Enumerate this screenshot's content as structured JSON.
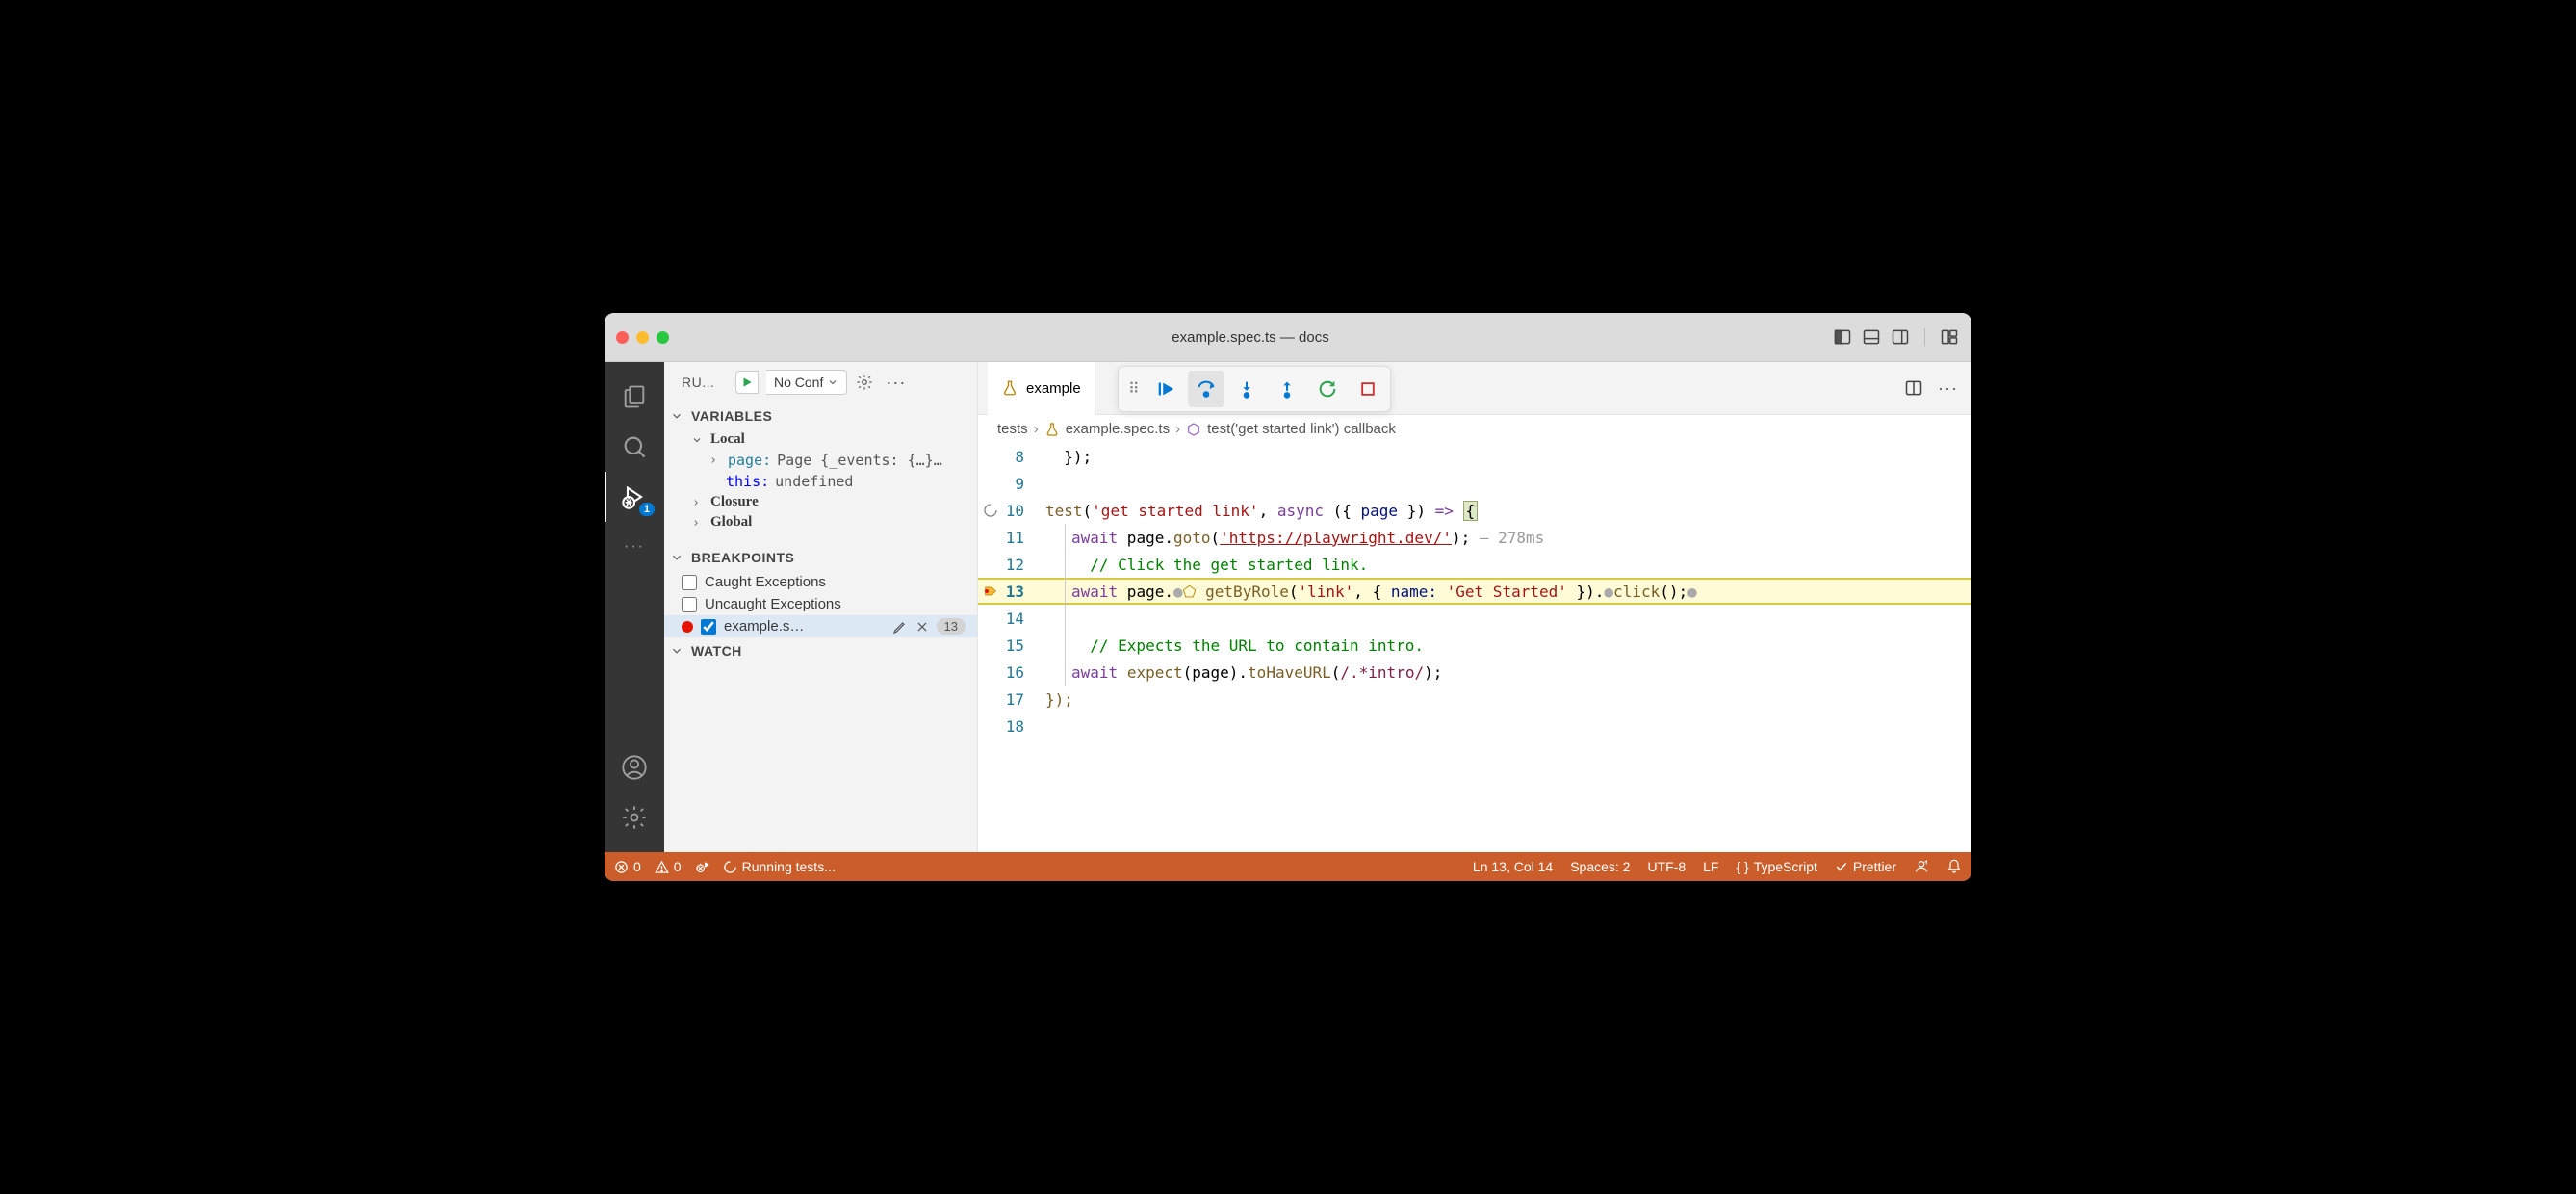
{
  "window_title": "example.spec.ts — docs",
  "activitybar": {
    "debug_badge": "1"
  },
  "sidebar": {
    "run_label": "RU...",
    "config_label": "No Conf",
    "sections": {
      "variables": "VARIABLES",
      "local": "Local",
      "closure": "Closure",
      "global": "Global",
      "breakpoints": "BREAKPOINTS",
      "watch": "WATCH"
    },
    "vars": {
      "page_name": "page:",
      "page_val": " Page {_events: {…}…",
      "this_name": "this:",
      "this_val": " undefined"
    },
    "bp": {
      "caught": "Caught Exceptions",
      "uncaught": "Uncaught Exceptions",
      "file_label": "example.s…",
      "line_badge": "13"
    }
  },
  "tab": {
    "label": "example"
  },
  "breadcrumb": {
    "a": "tests",
    "b": "example.spec.ts",
    "c": "test('get started link') callback"
  },
  "code": {
    "l8": "  });",
    "l9": "",
    "l10_a": "test",
    "l10_b": "(",
    "l10_c": "'get started link'",
    "l10_d": ", ",
    "l10_e": "async",
    "l10_f": " ({ ",
    "l10_g": "page",
    "l10_h": " }) ",
    "l10_i": "=>",
    "l10_j": " ",
    "l10_k": "{",
    "l11_a": "  ",
    "l11_b": "await",
    "l11_c": " page.",
    "l11_d": "goto",
    "l11_e": "(",
    "l11_f": "'https://playwright.dev/'",
    "l11_g": "); ",
    "l11_h": "— 278ms",
    "l12": "  // Click the get started link.",
    "l13_a": "  ",
    "l13_b": "await",
    "l13_c": " page.",
    "l13_d": "getByRole",
    "l13_e": "(",
    "l13_f": "'link'",
    "l13_g": ", { ",
    "l13_h": "name:",
    "l13_i": " ",
    "l13_j": "'Get Started'",
    "l13_k": " }).",
    "l13_l": "click",
    "l13_m": "();",
    "l14": "",
    "l15": "  // Expects the URL to contain intro.",
    "l16_a": "  ",
    "l16_b": "await",
    "l16_c": " ",
    "l16_d": "expect",
    "l16_e": "(page).",
    "l16_f": "toHaveURL",
    "l16_g": "(",
    "l16_h": "/.*intro/",
    "l16_i": ");",
    "l17": "});",
    "l18": ""
  },
  "line_numbers": [
    "8",
    "9",
    "10",
    "11",
    "12",
    "13",
    "14",
    "15",
    "16",
    "17",
    "18"
  ],
  "status": {
    "errors": "0",
    "warnings": "0",
    "running": "Running tests...",
    "cursor": "Ln 13, Col 14",
    "spaces": "Spaces: 2",
    "encoding": "UTF-8",
    "eol": "LF",
    "lang": "TypeScript",
    "prettier": "Prettier"
  }
}
